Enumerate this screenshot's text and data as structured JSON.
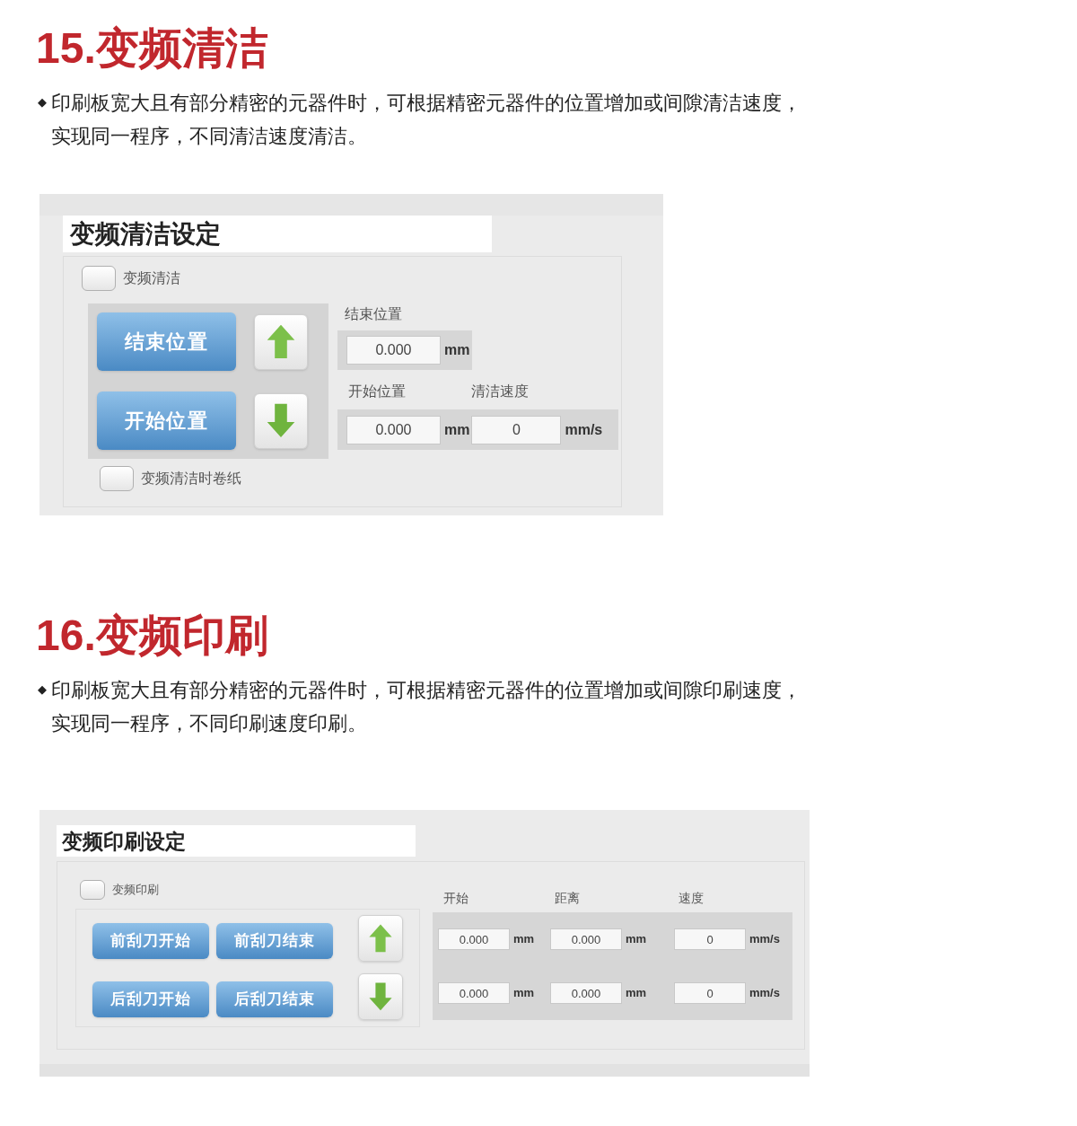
{
  "sections": [
    {
      "heading_number": "15.",
      "heading_title": "变频清洁",
      "bullet": "◆",
      "description_lines": [
        "印刷板宽大且有部分精密的元器件时，可根据精密元器件的位置增加或间隙清洁速度，",
        "实现同一程序，不同清洁速度清洁。"
      ],
      "panel": {
        "kind": "cleaning",
        "title": "变频清洁设定",
        "enable_checkbox": {
          "label": "变频清洁",
          "checked": false
        },
        "buttons": [
          "结束位置",
          "开始位置"
        ],
        "end_label": "结束位置",
        "end_field": {
          "value": "0.000",
          "unit": "mm"
        },
        "start_label": "开始位置",
        "speed_label": "清洁速度",
        "start_field": {
          "value": "0.000",
          "unit": "mm"
        },
        "speed_field": {
          "value": "0",
          "unit": "mm/s"
        },
        "paper_checkbox": {
          "label": "变频清洁时卷纸",
          "checked": false
        }
      }
    },
    {
      "heading_number": "16.",
      "heading_title": "变频印刷",
      "bullet": "◆",
      "description_lines": [
        "印刷板宽大且有部分精密的元器件时，可根据精密元器件的位置增加或间隙印刷速度，",
        "实现同一程序，不同印刷速度印刷。"
      ],
      "panel": {
        "kind": "printing",
        "title": "变频印刷设定",
        "enable_checkbox": {
          "label": "变频印刷",
          "checked": false
        },
        "button_rows": [
          [
            "前刮刀开始",
            "前刮刀结束"
          ],
          [
            "后刮刀开始",
            "后刮刀结束"
          ]
        ],
        "column_labels": [
          "开始",
          "距离",
          "速度"
        ],
        "field_rows": [
          [
            {
              "value": "0.000",
              "unit": "mm"
            },
            {
              "value": "0.000",
              "unit": "mm"
            },
            {
              "value": "0",
              "unit": "mm/s"
            }
          ],
          [
            {
              "value": "0.000",
              "unit": "mm"
            },
            {
              "value": "0.000",
              "unit": "mm"
            },
            {
              "value": "0",
              "unit": "mm/s"
            }
          ]
        ]
      }
    }
  ]
}
